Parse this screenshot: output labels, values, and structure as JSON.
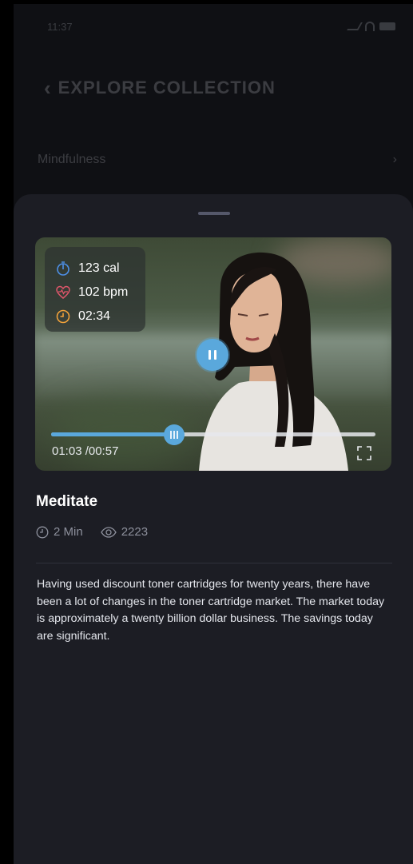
{
  "status_bar": {
    "time": "11:37"
  },
  "background": {
    "header_title": "EXPLORE COLLECTION",
    "section_title": "Mindfulness"
  },
  "video": {
    "stats": [
      {
        "icon": "timer-icon",
        "value": "123 cal",
        "color": "#4d8fe6"
      },
      {
        "icon": "heart-rate-icon",
        "value": "102 bpm",
        "color": "#e0566b"
      },
      {
        "icon": "clock-icon",
        "value": "02:34",
        "color": "#f0a13a"
      }
    ],
    "progress_fraction": 0.38,
    "time_display": "01:03 /00:57",
    "state": "playing",
    "accent_color": "#5aa8dc"
  },
  "detail": {
    "title": "Meditate",
    "duration": "2 Min",
    "views": "2223",
    "description": "Having used discount toner cartridges for twenty years, there have been a lot of changes in the toner cartridge market. The market today is approximately a twenty billion dollar business. The savings today are significant."
  }
}
